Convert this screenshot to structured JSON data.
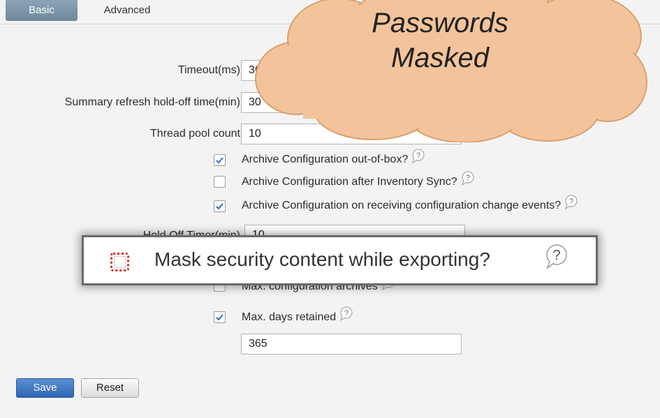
{
  "tabs": {
    "basic": "Basic",
    "advanced": "Advanced"
  },
  "form": {
    "timeout_label": "Timeout(ms)",
    "timeout_value": "360",
    "summary_label": "Summary refresh hold-off time(min)",
    "summary_value": "30",
    "thread_label": "Thread pool count",
    "thread_value": "10",
    "archive_oob_label": "Archive Configuration out-of-box?",
    "archive_oob_checked": true,
    "archive_inv_label": "Archive Configuration after Inventory Sync?",
    "archive_inv_checked": false,
    "archive_evt_label": "Archive Configuration on receiving configuration change events?",
    "archive_evt_checked": true,
    "hold_off_label": "Hold Off Timer(min)",
    "hold_off_value": "10",
    "max_archives_label": "Max. configuration archives",
    "max_archives_checked": false,
    "max_days_label": "Max. days retained",
    "max_days_checked": true,
    "max_days_value": "365"
  },
  "buttons": {
    "save": "Save",
    "reset": "Reset"
  },
  "callout": {
    "mask_label": "Mask security content while exporting?",
    "mask_checked": false
  },
  "cloud": {
    "line1": "Passwords",
    "line2": "Masked"
  },
  "colors": {
    "tab_active": "#7b94a6",
    "save_button": "#2f66b3",
    "checkmark": "#2b6cc4",
    "callout_highlight": "#d62b2b",
    "cloud_fill": "#f3c49b"
  },
  "icons": {
    "help": "question-bubble-icon",
    "check": "checkmark-icon"
  }
}
